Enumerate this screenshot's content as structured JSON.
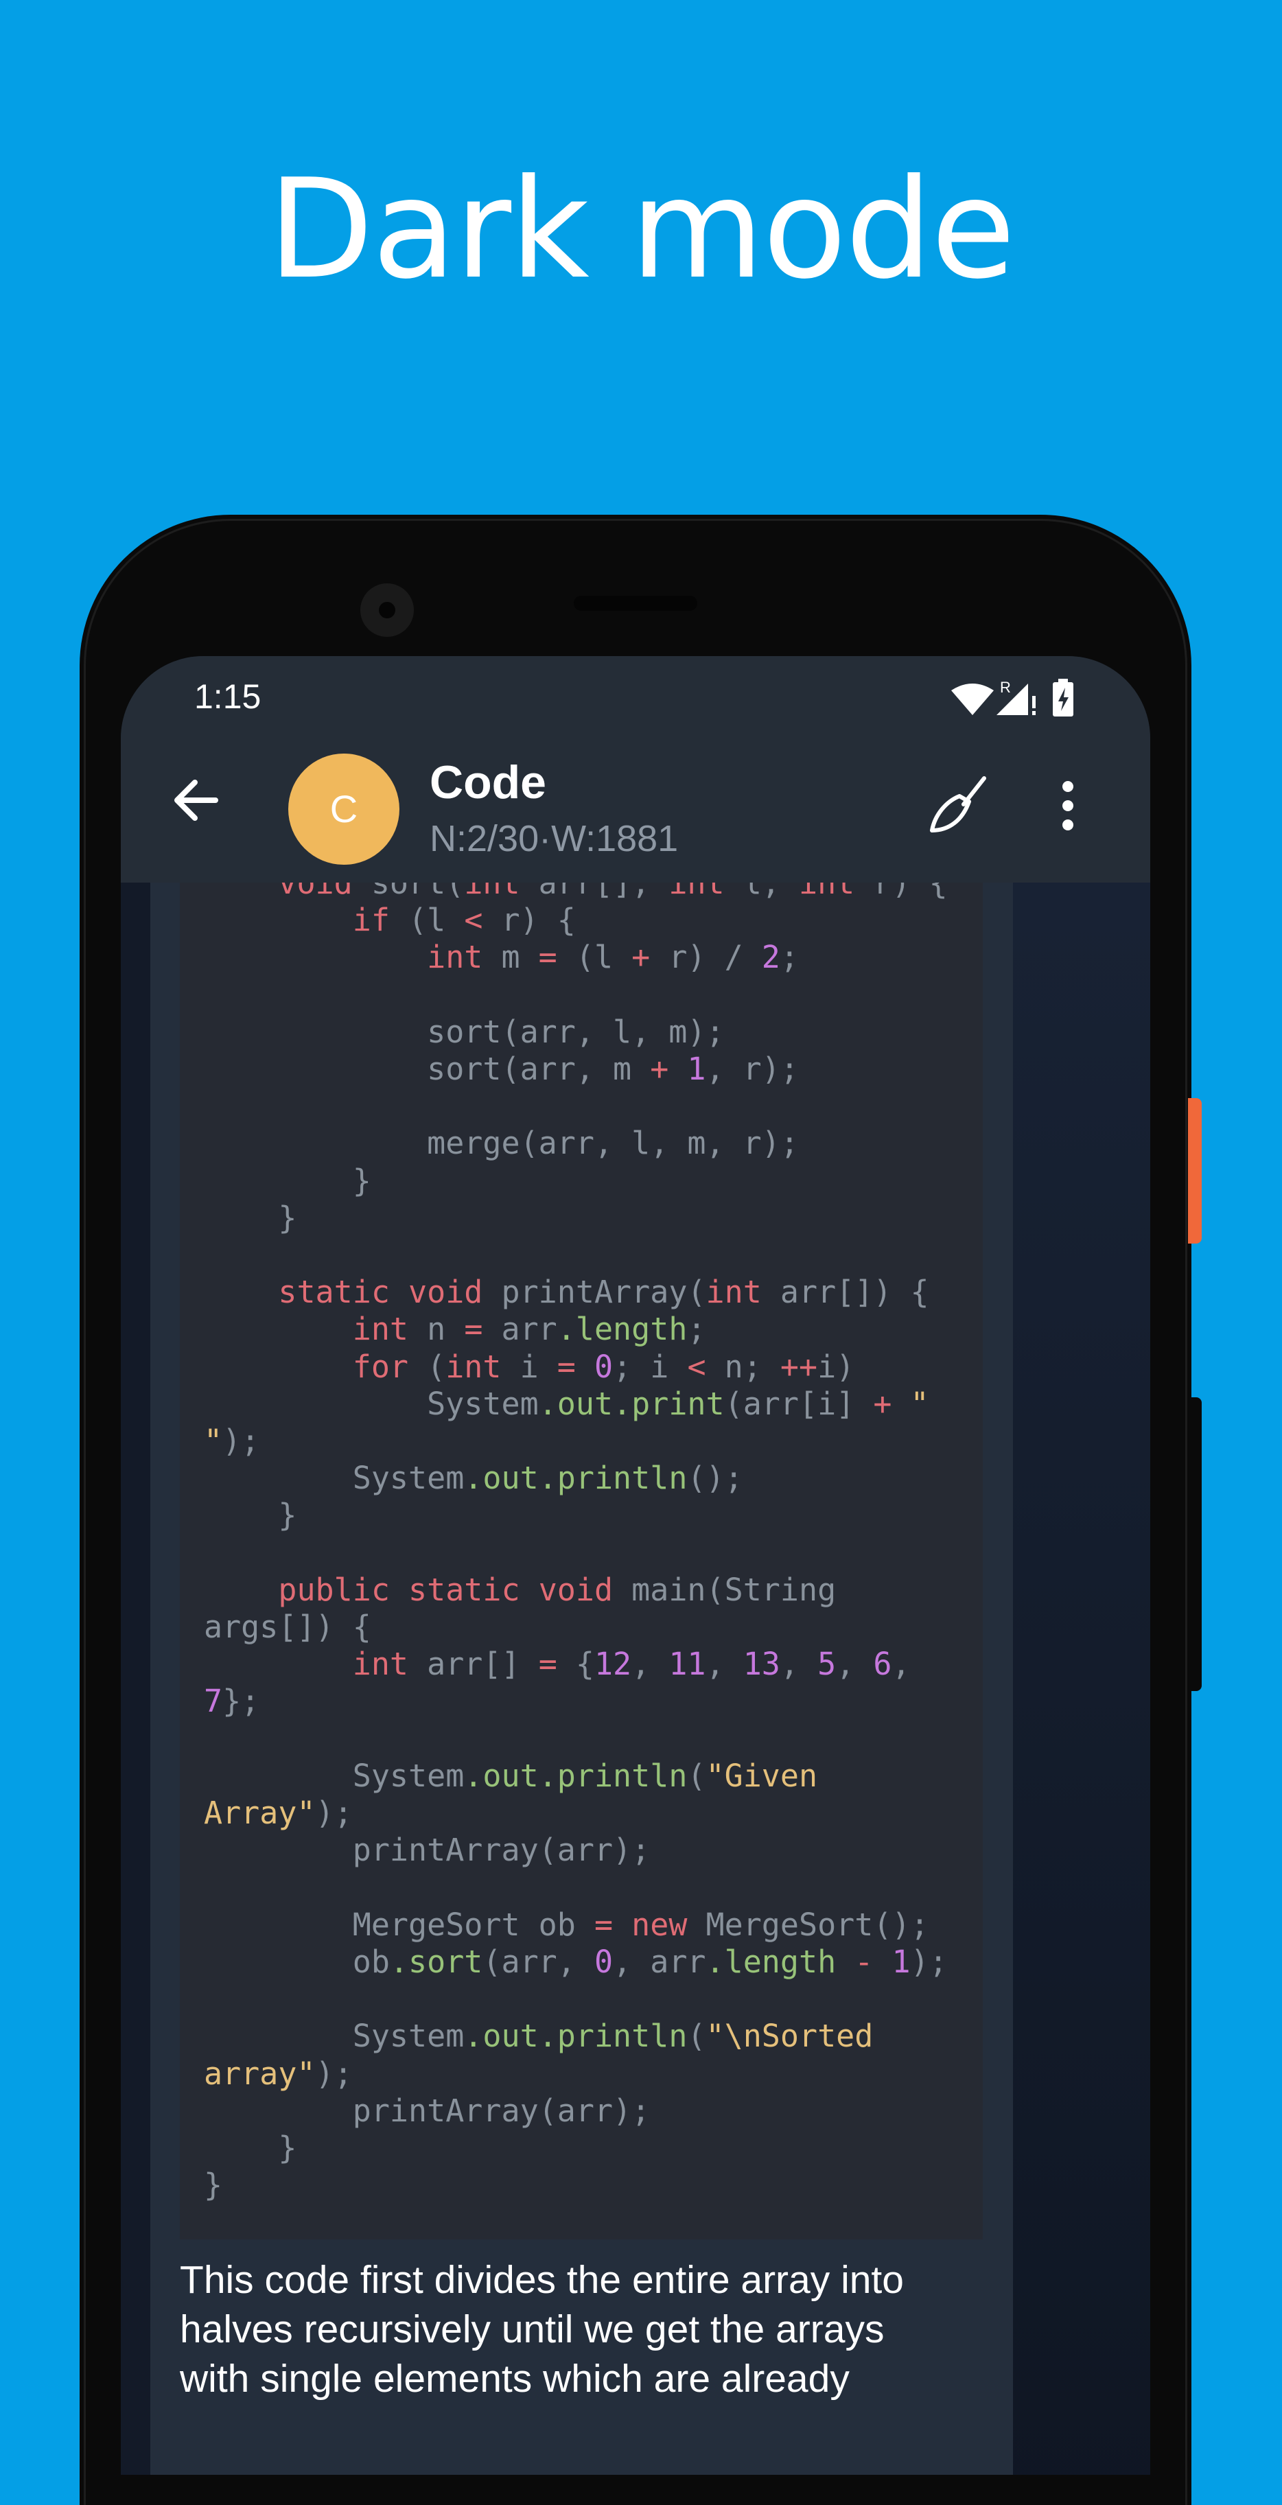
{
  "promo": {
    "title": "Dark mode"
  },
  "status_bar": {
    "time": "1:15",
    "icons": [
      "wifi-icon",
      "signal-roaming-icon",
      "battery-charging-icon"
    ],
    "roaming_label": "R"
  },
  "app_bar": {
    "avatar_letter": "C",
    "title": "Code",
    "subtitle": "N:2/30·W:1881",
    "icons": [
      "back-arrow-icon",
      "broom-icon",
      "more-vert-icon"
    ]
  },
  "code_lines": [
    "    void sort(int arr[], int l, int r) {",
    "        if (l < r) {",
    "            int m = (l + r) / 2;",
    "",
    "            sort(arr, l, m);",
    "            sort(arr, m + 1, r);",
    "",
    "            merge(arr, l, m, r);",
    "        }",
    "    }",
    "",
    "    static void printArray(int arr[]) {",
    "        int n = arr.length;",
    "        for (int i = 0; i < n; ++i)",
    "            System.out.print(arr[i] + \"",
    "\");",
    "        System.out.println();",
    "    }",
    "",
    "    public static void main(String",
    "args[]) {",
    "        int arr[] = {12, 11, 13, 5, 6,",
    "7};",
    "",
    "        System.out.println(\"Given",
    "Array\");",
    "        printArray(arr);",
    "",
    "        MergeSort ob = new MergeSort();",
    "        ob.sort(arr, 0, arr.length - 1);",
    "",
    "        System.out.println(\"\\nSorted",
    "array\");",
    "        printArray(arr);",
    "    }",
    "}"
  ],
  "message": {
    "lines": [
      "This code first divides the entire array into",
      "halves recursively until we get the arrays",
      "with single elements which are already"
    ]
  },
  "colors": {
    "background": "#049fe6",
    "app_bar": "#252d37",
    "avatar": "#f0b85c",
    "code_bg": "#262a33",
    "keyword": "#e06c75",
    "number": "#c678dd",
    "member": "#98c379",
    "string": "#e5c07b"
  }
}
